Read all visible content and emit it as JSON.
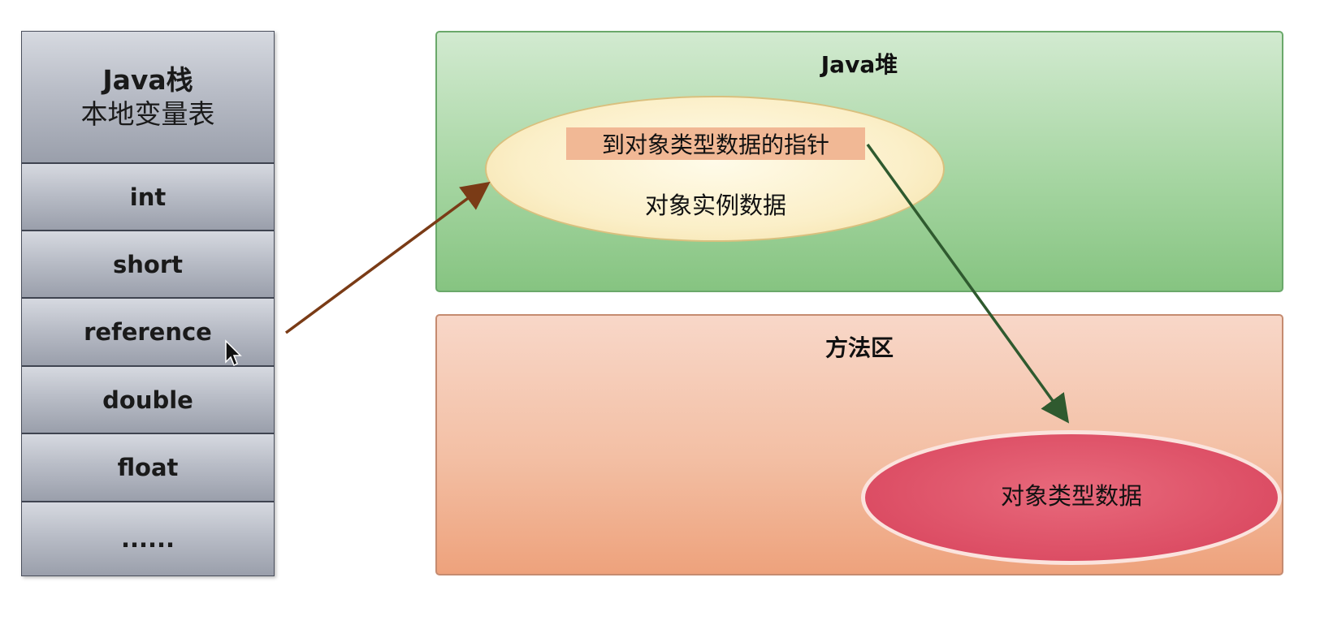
{
  "stack": {
    "header_line1": "Java栈",
    "header_line2": "本地变量表",
    "items": [
      "int",
      "short",
      "reference",
      "double",
      "float",
      "......"
    ]
  },
  "heap": {
    "title": "Java堆",
    "pointer_label": "到对象类型数据的指针",
    "instance_label": "对象实例数据"
  },
  "method_area": {
    "title": "方法区",
    "type_label": "对象类型数据"
  },
  "colors": {
    "arrow_reference": "#7a3b16",
    "arrow_pointer": "#2f5a2f",
    "heap_fill": "#a7d6a3",
    "method_fill": "#f3bfa4",
    "type_ellipse": "#dc4d64",
    "object_ellipse": "#fbefc8"
  }
}
